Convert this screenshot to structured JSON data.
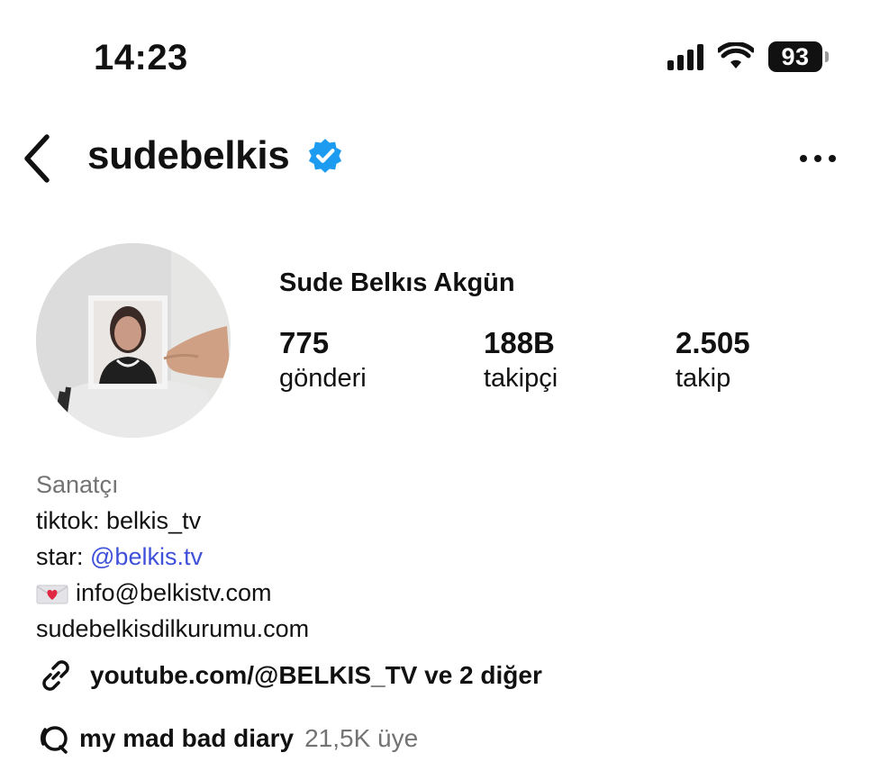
{
  "status_bar": {
    "time": "14:23",
    "battery": "93",
    "icons": [
      "signal-icon",
      "wifi-icon",
      "battery-icon"
    ]
  },
  "header": {
    "username": "sudebelkis",
    "icons": [
      "back-arrow-icon",
      "verified-badge-icon",
      "more-options-icon"
    ],
    "accent_color": "#1d9bf0"
  },
  "profile": {
    "full_name": "Sude Belkıs Akgün",
    "stats": [
      {
        "value": "775",
        "label": "gönderi"
      },
      {
        "value": "188B",
        "label": "takipçi"
      },
      {
        "value": "2.505",
        "label": "takip"
      }
    ]
  },
  "bio": {
    "category": "Sanatçı",
    "line1": "tiktok: belkis_tv",
    "line2_prefix": "star: ",
    "line2_link": "@belkis.tv",
    "email": "info@belkistv.com",
    "website": "sudebelkisdilkurumu.com",
    "link_color": "#3f51d8"
  },
  "links": {
    "text": "youtube.com/@BELKIS_TV ve 2 diğer",
    "icon": "link-icon"
  },
  "channel": {
    "name": "my mad bad diary",
    "members": "21,5K üye",
    "icon": "broadcast-channel-icon"
  }
}
